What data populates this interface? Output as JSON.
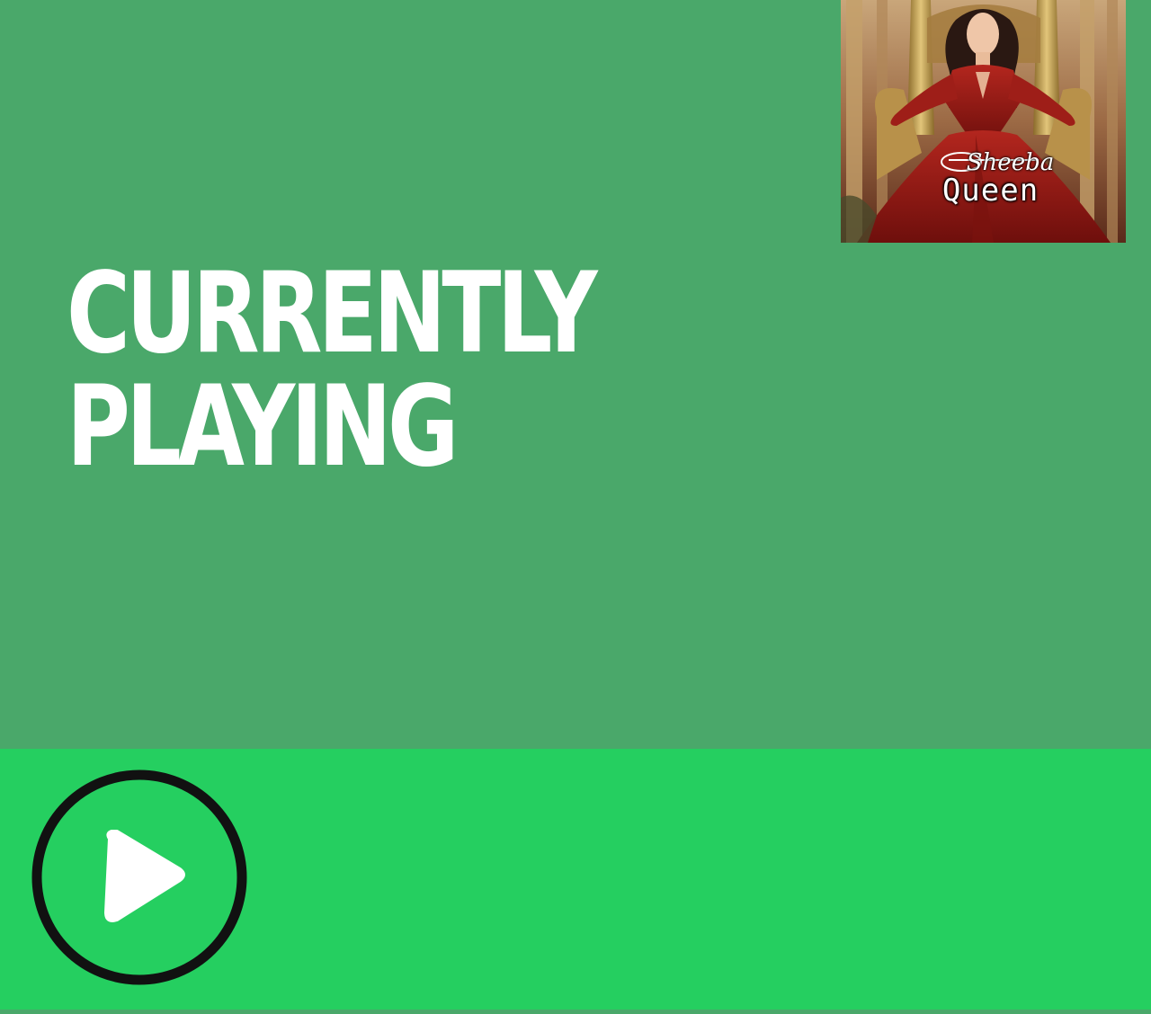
{
  "header": {
    "line1": "CURRENTLY",
    "line2": "PLAYING"
  },
  "album_art": {
    "title_script": "Sheeba",
    "title_main": "Queen"
  },
  "player": {
    "play_icon": "play-icon"
  },
  "colors": {
    "background": "#4aa86a",
    "player_bar": "#25cf60",
    "text": "#ffffff",
    "play_ring": "#111111"
  }
}
